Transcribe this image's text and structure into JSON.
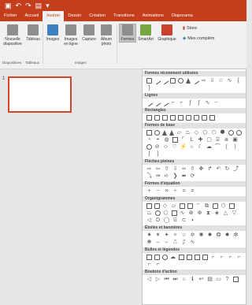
{
  "titlebar": {
    "bg": "#c43e1c"
  },
  "qat": {
    "save_icon": "save-icon",
    "undo_icon": "undo-icon",
    "redo_icon": "redo-icon",
    "start_icon": "slideshow-icon",
    "extra_icon": "customize-icon"
  },
  "tabs": [
    "Fichier",
    "Accueil",
    "Insérer",
    "Dessin",
    "Création",
    "Transitions",
    "Animations",
    "Diaporama"
  ],
  "ribbon": {
    "nouvelle_diapositive": "Nouvelle diapositive",
    "tableau": "Tableau",
    "images": "Images",
    "images_en_ligne": "Images en ligne",
    "capture": "Capture",
    "album_photo": "Album photo",
    "formes": "Formes",
    "smartart": "SmartArt",
    "graphique": "Graphique",
    "store": "Store",
    "mes_complements": "Mes complém",
    "groups": {
      "diapositives": "Diapositives",
      "tableaux": "Tableaux",
      "images": "Images"
    }
  },
  "slides": {
    "number": "1"
  },
  "gallery": {
    "categories": [
      "Formes récemment utilisées",
      "Lignes",
      "Rectangles",
      "Formes de base",
      "Flèches pleines",
      "Formes d'équation",
      "Organigrammes",
      "Étoiles et bannières",
      "Bulles et légendes",
      "Boutons d'action"
    ]
  }
}
